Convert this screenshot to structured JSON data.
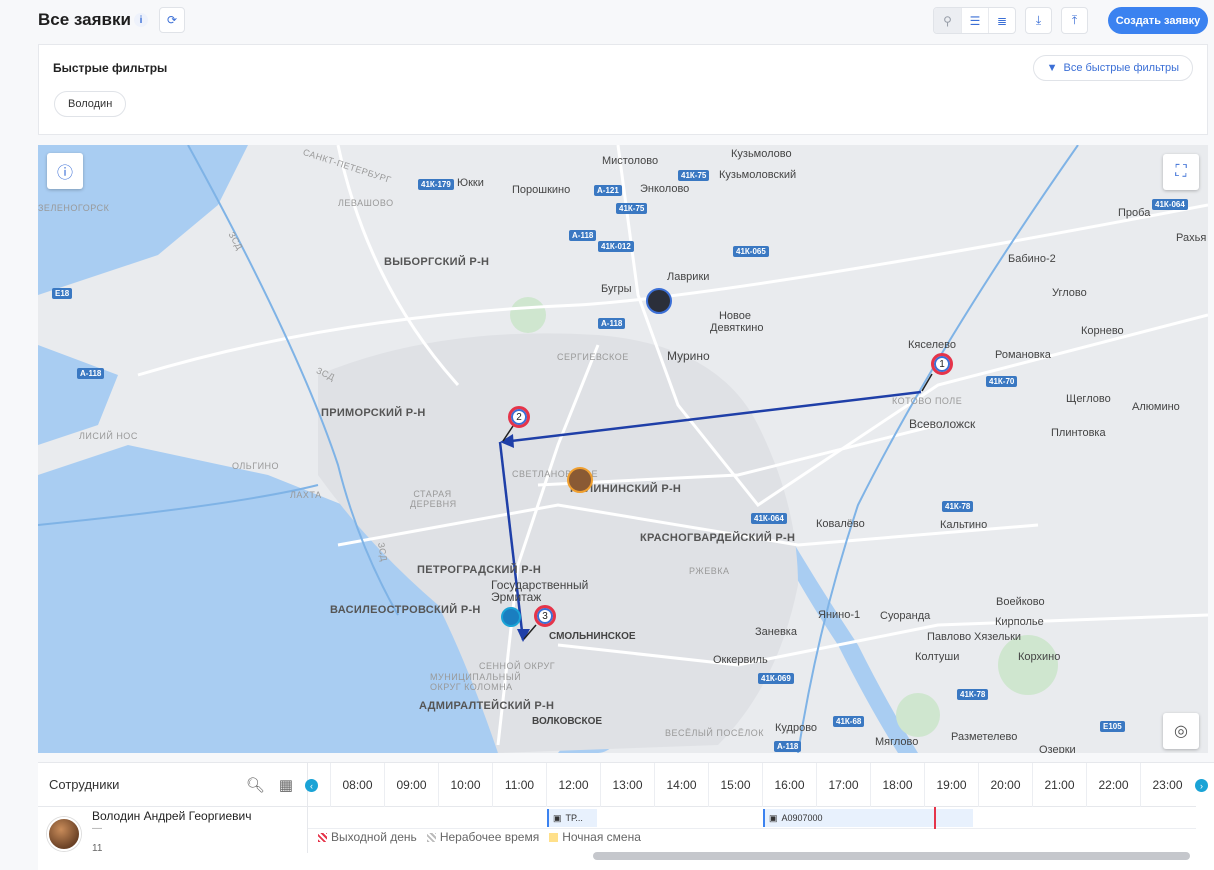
{
  "header": {
    "title": "Все заявки",
    "info_icon": "info-icon",
    "refresh_icon": "refresh-icon",
    "view_icons": [
      "map-pin-icon",
      "list-icon",
      "detailed-list-icon"
    ],
    "download_icon": "download-icon",
    "upload_icon": "upload-icon",
    "create_label": "Создать заявку"
  },
  "filters": {
    "title": "Быстрые фильтры",
    "chips": [
      "Володин"
    ],
    "all_label": "Все быстрые фильтры"
  },
  "map": {
    "districts": [
      "ВЫБОРГСКИЙ Р-Н",
      "ПРИМОРСКИЙ Р-Н",
      "КАЛИНИНСКИЙ Р-Н",
      "КРАСНОГВАРДЕЙСКИЙ Р-Н",
      "ПЕТРОГРАДСКИЙ Р-Н",
      "ВАСИЛЕОСТРОВСКИЙ Р-Н",
      "АДМИРАЛТЕЙСКИЙ Р-Н"
    ],
    "places": [
      "Мистолово",
      "Кузьмолово",
      "Кузьмоловский",
      "Юкки",
      "Порошкино",
      "Энколово",
      "Лаврики",
      "Бугры",
      "Новое Девяткино",
      "Мурино",
      "Кяселево",
      "Романовка",
      "Всеволожск",
      "Щеглово",
      "Алюмино",
      "Плинтовка",
      "Бабино-2",
      "Углово",
      "Корнево",
      "Проба",
      "Рахья",
      "Ковалёво",
      "Кальтино",
      "Янино-1",
      "Суоранда",
      "Воейково",
      "Кирполье",
      "Павлово",
      "Хязельки",
      "Колтуши",
      "Корхино",
      "Заневка",
      "Оккервиль",
      "Кудрово",
      "Мяглово",
      "Разметелево",
      "Озерки",
      "Государственный Эрмитаж",
      "СМОЛЬНИНСКОЕ",
      "ВОЛКОВСКОЕ"
    ],
    "small_places": [
      "САНКТ-ПЕТЕРБУРГ",
      "ЛЕВАШОВО",
      "СЕРГИЕВСКОЕ",
      "СВЕТЛАНОВСКОЕ",
      "ЛИСИЙ НОС",
      "ОЛЬГИНО",
      "ЛАХТА",
      "СТАРАЯ ДЕРЕВНЯ",
      "КОТОВО ПОЛЕ",
      "РЖЕВКА",
      "СЕННОЙ ОКРУГ",
      "МУНИЦИПАЛЬНЫЙ ОКРУГ КОЛОМНА",
      "ВЕСЁЛЫЙ ПОСЁЛОК",
      "ЗЕЛЕНОГОРСК"
    ],
    "roads": [
      "41К-179",
      "А-121",
      "41К-75",
      "41К-75",
      "А-118",
      "41К-012",
      "41К-065",
      "А-118",
      "41К-70",
      "41К-064",
      "А-118",
      "Е18",
      "41К-78",
      "41К-064",
      "41К-069",
      "41К-78",
      "41К-68",
      "А-118",
      "Е105",
      "ЗСД",
      "ЗСД",
      "ЗСД"
    ],
    "markers": [
      "1",
      "2",
      "3"
    ],
    "info_icon": "info-icon",
    "fullscreen_icon": "fullscreen-icon",
    "locate_icon": "locate-icon"
  },
  "schedule": {
    "employees_label": "Сотрудники",
    "hours": [
      "08:00",
      "09:00",
      "10:00",
      "11:00",
      "12:00",
      "13:00",
      "14:00",
      "15:00",
      "16:00",
      "17:00",
      "18:00",
      "19:00",
      "20:00",
      "21:00",
      "22:00",
      "23:00"
    ],
    "employee": {
      "name": "Володин Андрей Георгиевич",
      "subtitle": "—",
      "count": "11"
    },
    "tasks": [
      "ТР...",
      "А0907000"
    ],
    "legend": [
      "Выходной день",
      "Нерабочее время",
      "Ночная смена"
    ],
    "colors": {
      "accent": "#3b82f0",
      "marker_red": "#e5344a",
      "route": "#1f3fa8"
    }
  }
}
